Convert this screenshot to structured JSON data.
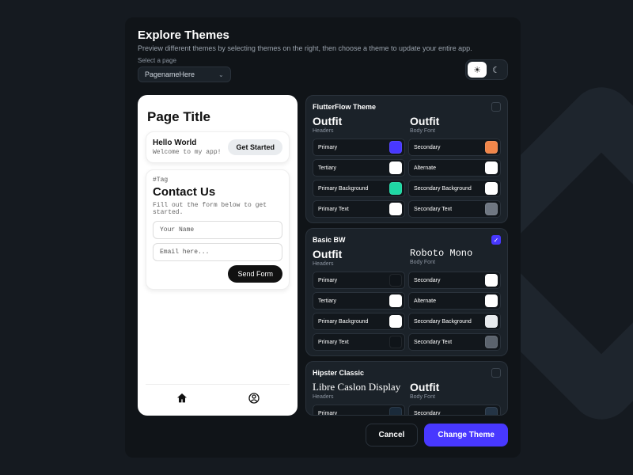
{
  "header": {
    "title": "Explore Themes",
    "subtitle": "Preview different themes by selecting themes on the right, then choose a theme to update your entire app.",
    "select_label": "Select a page",
    "page_name": "PagenameHere"
  },
  "mode": {
    "light_icon": "☀",
    "dark_icon": "☾"
  },
  "preview": {
    "page_title": "Page Title",
    "hello": {
      "title": "Hello World",
      "sub": "Welcome to my app!",
      "cta": "Get Started"
    },
    "contact": {
      "tag": "#Tag",
      "title": "Contact Us",
      "sub": "Fill out the form below to get started.",
      "name_ph": "Your Name",
      "email_ph": "Email here...",
      "send": "Send Form"
    }
  },
  "themes": [
    {
      "name": "FlutterFlow Theme",
      "selected": false,
      "header_font": "Outfit",
      "body_font": "Outfit",
      "body_font_class": "",
      "swatches": [
        {
          "label": "Primary",
          "color": "#4838ff"
        },
        {
          "label": "Secondary",
          "color": "#f0864a"
        },
        {
          "label": "Tertiary",
          "color": "#ffffff"
        },
        {
          "label": "Alternate",
          "color": "#ffffff"
        },
        {
          "label": "Primary Background",
          "color": "#1fd8a4"
        },
        {
          "label": "Secondary Background",
          "color": "#ffffff"
        },
        {
          "label": "Primary Text",
          "color": "#ffffff"
        },
        {
          "label": "Secondary Text",
          "color": "#6f7782"
        }
      ]
    },
    {
      "name": "Basic BW",
      "selected": true,
      "header_font": "Outfit",
      "body_font": "Roboto Mono",
      "body_font_class": "mono",
      "swatches": [
        {
          "label": "Primary",
          "color": "#0f1419"
        },
        {
          "label": "Secondary",
          "color": "#ffffff"
        },
        {
          "label": "Tertiary",
          "color": "#ffffff"
        },
        {
          "label": "Alternate",
          "color": "#ffffff"
        },
        {
          "label": "Primary Background",
          "color": "#ffffff"
        },
        {
          "label": "Secondary Background",
          "color": "#e8ebee"
        },
        {
          "label": "Primary Text",
          "color": "#0f1419"
        },
        {
          "label": "Secondary Text",
          "color": "#5b636d"
        }
      ]
    },
    {
      "name": "Hipster Classic",
      "selected": false,
      "header_font": "Libre Caslon Display",
      "header_font_class": "serif",
      "body_font": "Outfit",
      "body_font_class": "",
      "swatches": [
        {
          "label": "Primary",
          "color": "#1a2a3a"
        },
        {
          "label": "Secondary",
          "color": "#243445"
        }
      ]
    }
  ],
  "font_labels": {
    "headers": "Headers",
    "body": "Body Font"
  },
  "footer": {
    "cancel": "Cancel",
    "apply": "Change Theme"
  }
}
